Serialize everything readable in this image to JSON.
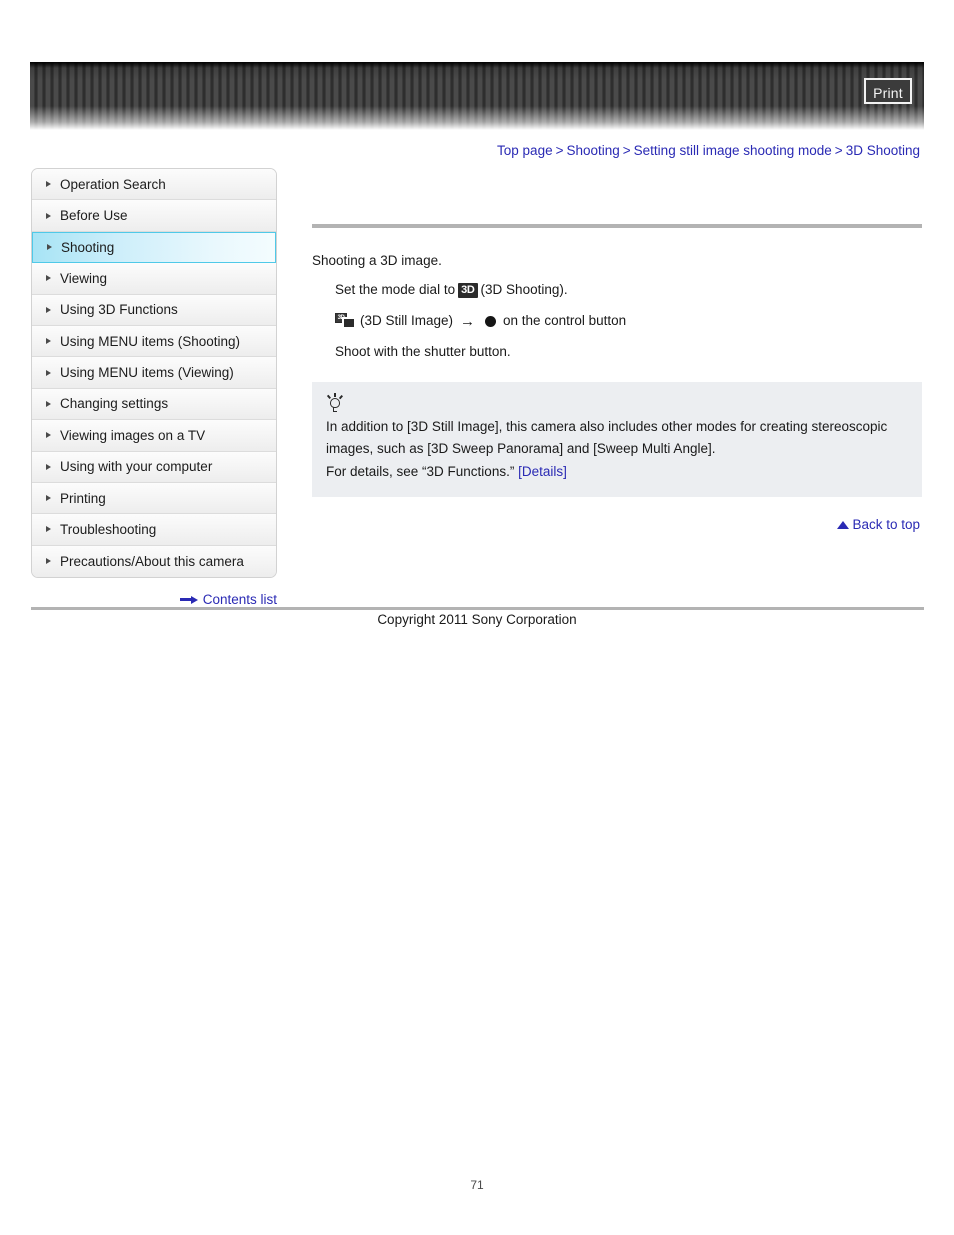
{
  "header": {
    "print_label": "Print"
  },
  "breadcrumb": {
    "items": [
      {
        "label": "Top page"
      },
      {
        "label": "Shooting"
      },
      {
        "label": "Setting still image shooting mode"
      },
      {
        "label": "3D Shooting"
      }
    ],
    "separator": ">"
  },
  "sidebar": {
    "items": [
      {
        "label": "Operation Search",
        "selected": false
      },
      {
        "label": "Before Use",
        "selected": false
      },
      {
        "label": "Shooting",
        "selected": true
      },
      {
        "label": "Viewing",
        "selected": false
      },
      {
        "label": "Using 3D Functions",
        "selected": false
      },
      {
        "label": "Using MENU items (Shooting)",
        "selected": false
      },
      {
        "label": "Using MENU items (Viewing)",
        "selected": false
      },
      {
        "label": "Changing settings",
        "selected": false
      },
      {
        "label": "Viewing images on a TV",
        "selected": false
      },
      {
        "label": "Using with your computer",
        "selected": false
      },
      {
        "label": "Printing",
        "selected": false
      },
      {
        "label": "Troubleshooting",
        "selected": false
      },
      {
        "label": "Precautions/About this camera",
        "selected": false
      }
    ],
    "contents_list_label": "Contents list"
  },
  "main": {
    "intro": "Shooting a 3D image.",
    "step1_prefix": "Set the mode dial to",
    "step1_badge": "3D",
    "step1_suffix": "(3D Shooting).",
    "step2_icon_badge": "3D",
    "step2_label": "(3D Still Image)",
    "step2_arrow": "→",
    "step2_suffix": "on the control button",
    "step3": "Shoot with the shutter button.",
    "tip": {
      "line1": "In addition to [3D Still Image], this camera also includes other modes for creating stereoscopic",
      "line2": "images, such as [3D Sweep Panorama] and [Sweep Multi Angle].",
      "line3": "For details, see “3D Functions.”",
      "details_link": "[Details]"
    }
  },
  "footer": {
    "back_to_top": "Back to top",
    "copyright": "Copyright 2011 Sony Corporation",
    "page_number": "71"
  },
  "colors": {
    "link": "#2a2ab4",
    "selected_accent": "#4fc9e8",
    "rule": "#b3b3b3",
    "tip_bg": "#eceef1"
  }
}
